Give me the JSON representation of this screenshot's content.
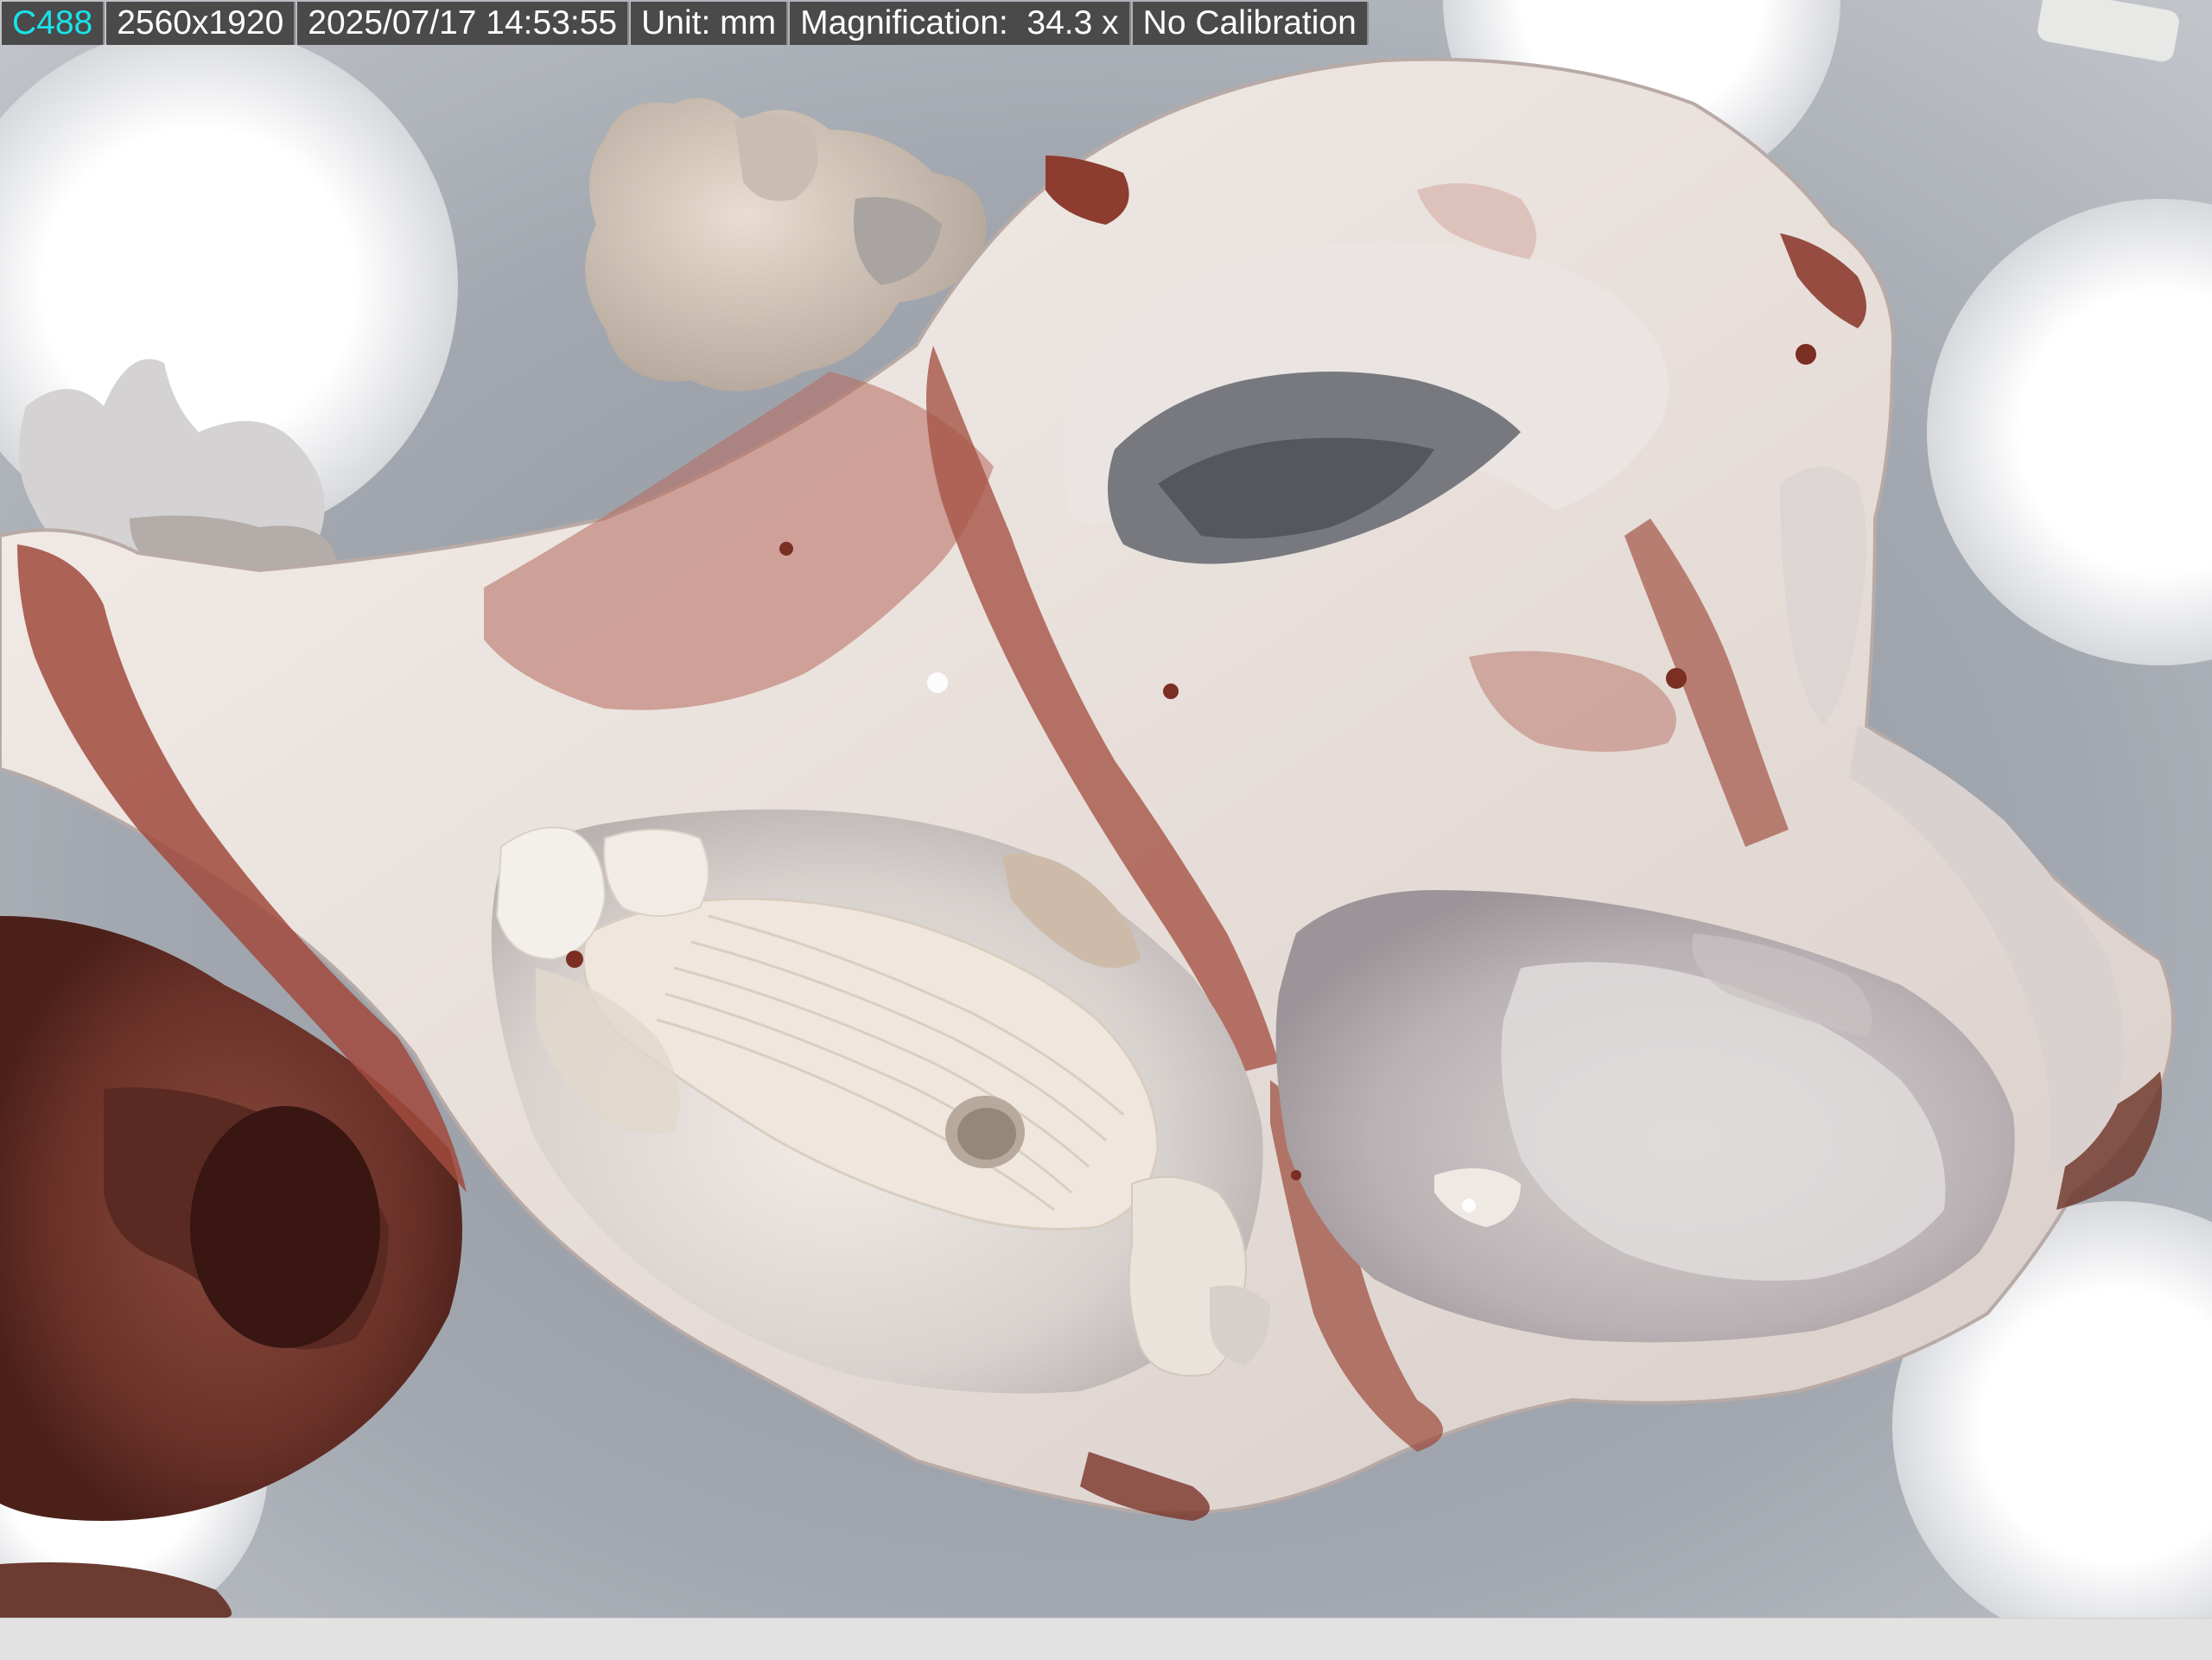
{
  "info_bar": {
    "camera_id": "C488",
    "resolution": "2560x1920",
    "datetime": "2025/07/17 14:53:55",
    "unit_label": "Unit: mm",
    "magnification_label": "Magnification:",
    "magnification_value": "34.3 x",
    "calibration": "No Calibration"
  },
  "colors": {
    "camera_id_text": "#19e3ea",
    "bar_background": "#4a4a4a",
    "bar_text": "#ffffff",
    "backdrop": "#9ea3ab",
    "specimen_shell": "#ece4df",
    "specimen_stain": "#a5564a"
  },
  "image_subject": "microscope-specimen"
}
